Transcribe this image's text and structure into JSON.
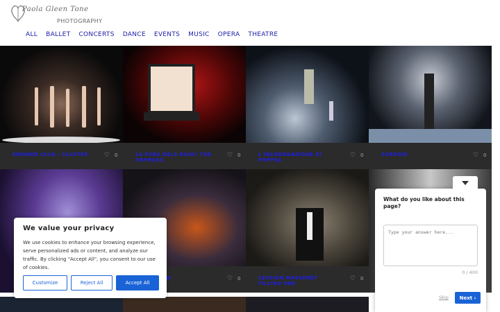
{
  "logo": {
    "script": "Paola Gleen Tone",
    "sub": "PHOTOGRAPHY"
  },
  "nav": [
    "ALL",
    "BALLET",
    "CONCERTS",
    "DANCE",
    "EVENTS",
    "MUSIC",
    "OPERA",
    "THEATRE"
  ],
  "tiles": [
    {
      "title": "EDWARD CLUG - CLUSTER",
      "count": "0"
    },
    {
      "title": "LA FURA DELS BAUS: THE ORPHEUS",
      "count": "0"
    },
    {
      "title": "L'INCORONAZIONE DI POPPEA",
      "count": "0"
    },
    {
      "title": "SORROW",
      "count": "0"
    },
    {
      "title": "",
      "count": ""
    },
    {
      "title": "THE GIRL IN",
      "count": "0"
    },
    {
      "title": "SESSION MASSENET FILLING ONE",
      "count": "0"
    }
  ],
  "cookie": {
    "title": "We value your privacy",
    "body": "We use cookies to enhance your browsing experience, serve personalized ads or content, and analyze our traffic. By clicking \"Accept All\", you consent to our use of cookies.",
    "customize": "Customize",
    "reject": "Reject All",
    "accept": "Accept All"
  },
  "survey": {
    "question": "What do you like about this page?",
    "placeholder": "Type your answer here...",
    "counter": "0 / 400",
    "skip": "Skip",
    "next": "Next ›"
  }
}
